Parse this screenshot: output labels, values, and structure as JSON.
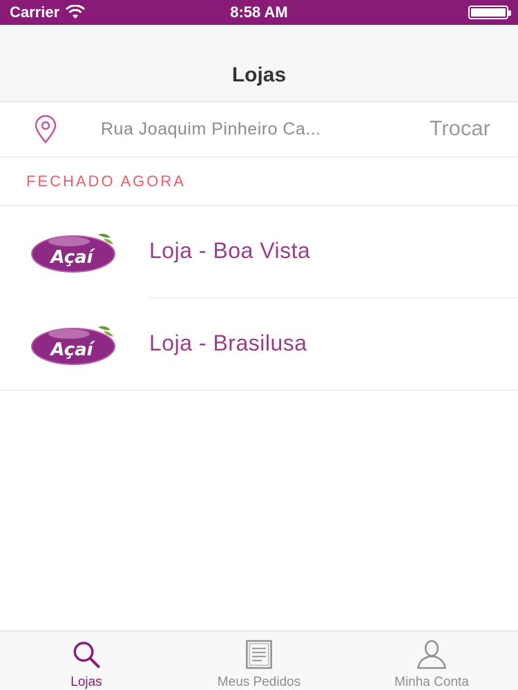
{
  "status_bar": {
    "carrier": "Carrier",
    "time": "8:58 AM"
  },
  "nav": {
    "title": "Lojas"
  },
  "address": {
    "text": "Rua Joaquim Pinheiro Ca...",
    "change_label": "Trocar",
    "icon": "map-pin-icon"
  },
  "section": {
    "title": "FECHADO AGORA",
    "color": "#ef5a6a"
  },
  "stores": [
    {
      "name": "Loja - Boa Vista",
      "logo_text": "Açaí"
    },
    {
      "name": "Loja - Brasilusa",
      "logo_text": "Açaí"
    }
  ],
  "tabs": [
    {
      "label": "Lojas",
      "icon": "search-icon",
      "active": true
    },
    {
      "label": "Meus Pedidos",
      "icon": "document-icon",
      "active": false
    },
    {
      "label": "Minha Conta",
      "icon": "user-icon",
      "active": false
    }
  ],
  "colors": {
    "brand": "#8a1a78",
    "store_text": "#9b3d8f",
    "inactive": "#8e8e8e"
  }
}
